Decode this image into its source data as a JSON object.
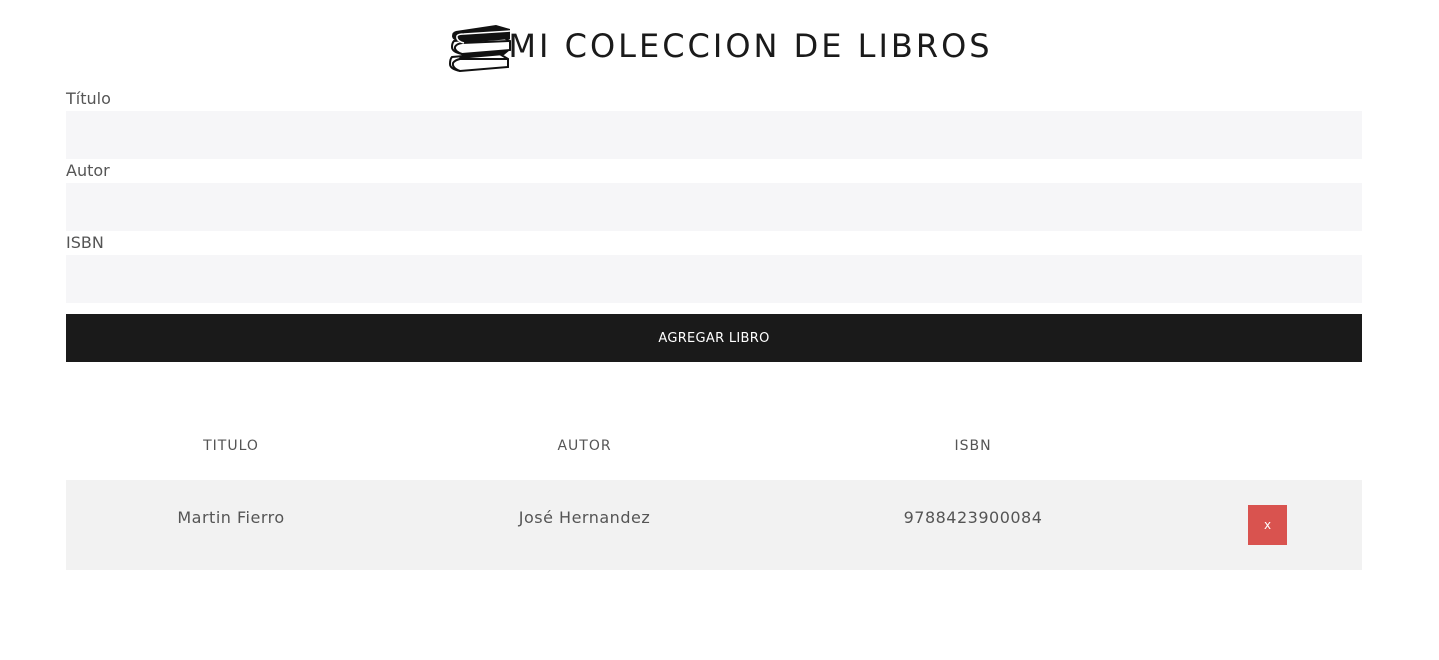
{
  "header": {
    "title": "MI COLECCION DE LIBROS",
    "icon": "books-stack-icon"
  },
  "form": {
    "fields": [
      {
        "label": "Título",
        "value": ""
      },
      {
        "label": "Autor",
        "value": ""
      },
      {
        "label": "ISBN",
        "value": ""
      }
    ],
    "submit_label": "AGREGAR LIBRO"
  },
  "table": {
    "headers": [
      "TITULO",
      "AUTOR",
      "ISBN",
      ""
    ],
    "rows": [
      {
        "titulo": "Martin Fierro",
        "autor": "José Hernandez",
        "isbn": "9788423900084",
        "delete_label": "x"
      }
    ]
  },
  "colors": {
    "dark": "#1a1a1a",
    "input_bg": "#f6f6f8",
    "row_bg": "#f2f2f2",
    "danger": "#d9534f"
  }
}
